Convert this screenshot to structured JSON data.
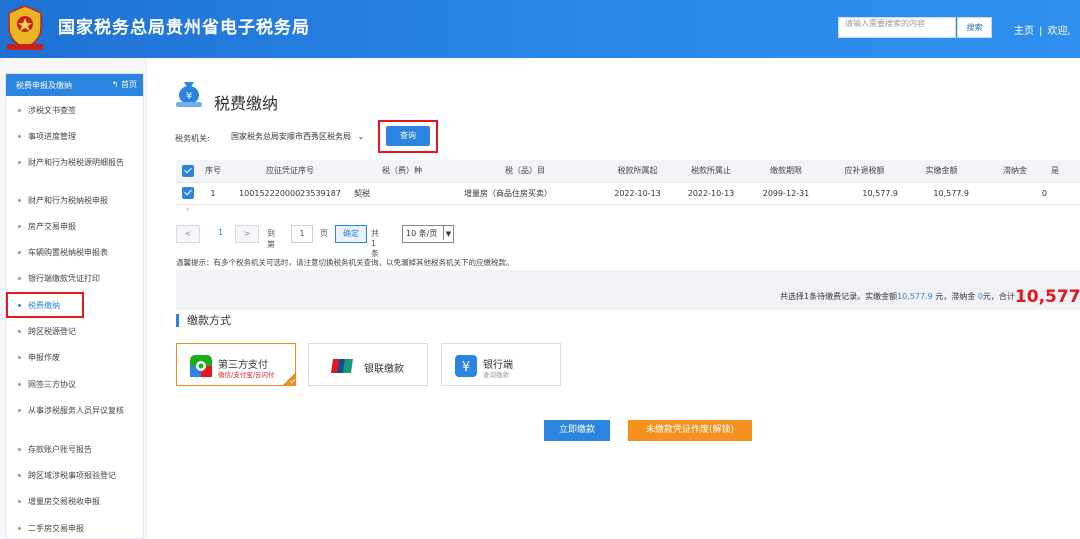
{
  "header": {
    "title": "国家税务总局贵州省电子税务局",
    "search_placeholder": "请输入需要搜索的内容",
    "search_button": "搜索",
    "home_link": "主页",
    "separator": "|",
    "welcome": "欢迎,"
  },
  "sidebar": {
    "title": "税费申报及缴纳",
    "home": "首页",
    "items": [
      {
        "label": "涉税文书查签"
      },
      {
        "label": "事项进度管理"
      },
      {
        "label": "财产和行为税税源明细报告"
      },
      {
        "label": "财产和行为税纳税申报"
      },
      {
        "label": "房产交易申报"
      },
      {
        "label": "车辆购置税纳税申报表"
      },
      {
        "label": "银行端缴款凭证打印"
      },
      {
        "label": "税费缴纳"
      },
      {
        "label": "跨区税源登记"
      },
      {
        "label": "申报作废"
      },
      {
        "label": "网签三方协议"
      },
      {
        "label": "从事涉税服务人员异议复核"
      },
      {
        "label": "存款账户账号报告"
      },
      {
        "label": "跨区域涉税事项报验登记"
      },
      {
        "label": "增量房交易税收申报"
      },
      {
        "label": "二手房交易申报"
      }
    ]
  },
  "main": {
    "page_title": "税费缴纳",
    "org_label": "税务机关:",
    "org_value": "国家税务总局安顺市西秀区税务局",
    "query_button": "查询",
    "table": {
      "headers": [
        "序号",
        "应征凭证序号",
        "税（费）种",
        "税（品）目",
        "税款所属起",
        "税款所属止",
        "缴款期限",
        "应补退税额",
        "实缴金额",
        "滞纳金",
        "是"
      ],
      "rows": [
        [
          "1",
          "10015222000023539187",
          "契税",
          "增量房（商品住房买卖）",
          "2022-10-13",
          "2022-10-13",
          "2099-12-31",
          "10,577.9",
          "10,577.9",
          "0",
          ""
        ]
      ]
    },
    "pager": {
      "prev": "<",
      "page": "1",
      "next": ">",
      "goto_label": "到第",
      "goto_value": "1",
      "page_unit": "页",
      "ok": "确定",
      "total": "共 1 条",
      "page_size": "10 条/页"
    },
    "tip": "温馨提示：有多个税务机关可选时，请注意切换税务机关查询，以免漏掉其他税务机关下的应缴税款。",
    "summary": {
      "prefix": "共选择1条待缴费记录。实缴金额",
      "paid": "10,577.9",
      "mid1": " 元，滞纳金 ",
      "late": "0",
      "mid2": "元，合计",
      "total": "10,577"
    },
    "payment_title": "缴款方式",
    "payment_methods": [
      {
        "name": "第三方支付",
        "sub": "微信/支付宝/云闪付",
        "icon": "third-party-pay-icon",
        "selected": true
      },
      {
        "name": "银联缴款",
        "sub": "",
        "icon": "unionpay-icon",
        "selected": false
      },
      {
        "name": "银行端",
        "sub": "查询缴款",
        "icon": "bank-icon",
        "selected": false
      }
    ],
    "pay_now": "立即缴款",
    "void_voucher": "未缴款凭证作废(解锁)"
  },
  "colors": {
    "primary": "#2a84e0",
    "header_bg": "#1f71d4",
    "highlight_red": "#e1191e",
    "orange": "#f5901e"
  }
}
